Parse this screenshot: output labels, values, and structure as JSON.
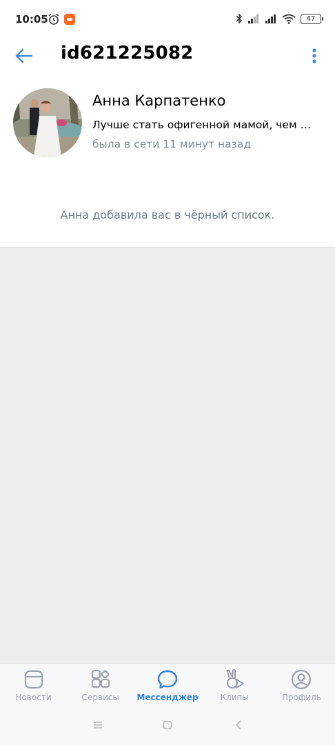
{
  "status_bar": {
    "time": "10:05",
    "battery": "47"
  },
  "header": {
    "title": "id621225082",
    "accent_color": "#3f8ae0"
  },
  "profile": {
    "name": "Анна Карпатенко",
    "status": "Лучше стать офигенной мамой, чем …",
    "last_seen": "была в сети 11 минут назад",
    "blocked_message": "Анна добавила вас в чёрный список."
  },
  "tabbar": {
    "active_color": "#2d81e0",
    "inactive_color": "#99a2ad",
    "items": [
      {
        "label": "Новости",
        "icon": "news-icon"
      },
      {
        "label": "Сервисы",
        "icon": "services-icon"
      },
      {
        "label": "Мессенджер",
        "icon": "messenger-icon",
        "active": true
      },
      {
        "label": "Клипы",
        "icon": "clips-icon"
      },
      {
        "label": "Профиль",
        "icon": "profile-icon"
      }
    ]
  },
  "system_nav": {
    "buttons": [
      "menu-icon",
      "home-icon",
      "back-icon"
    ]
  }
}
